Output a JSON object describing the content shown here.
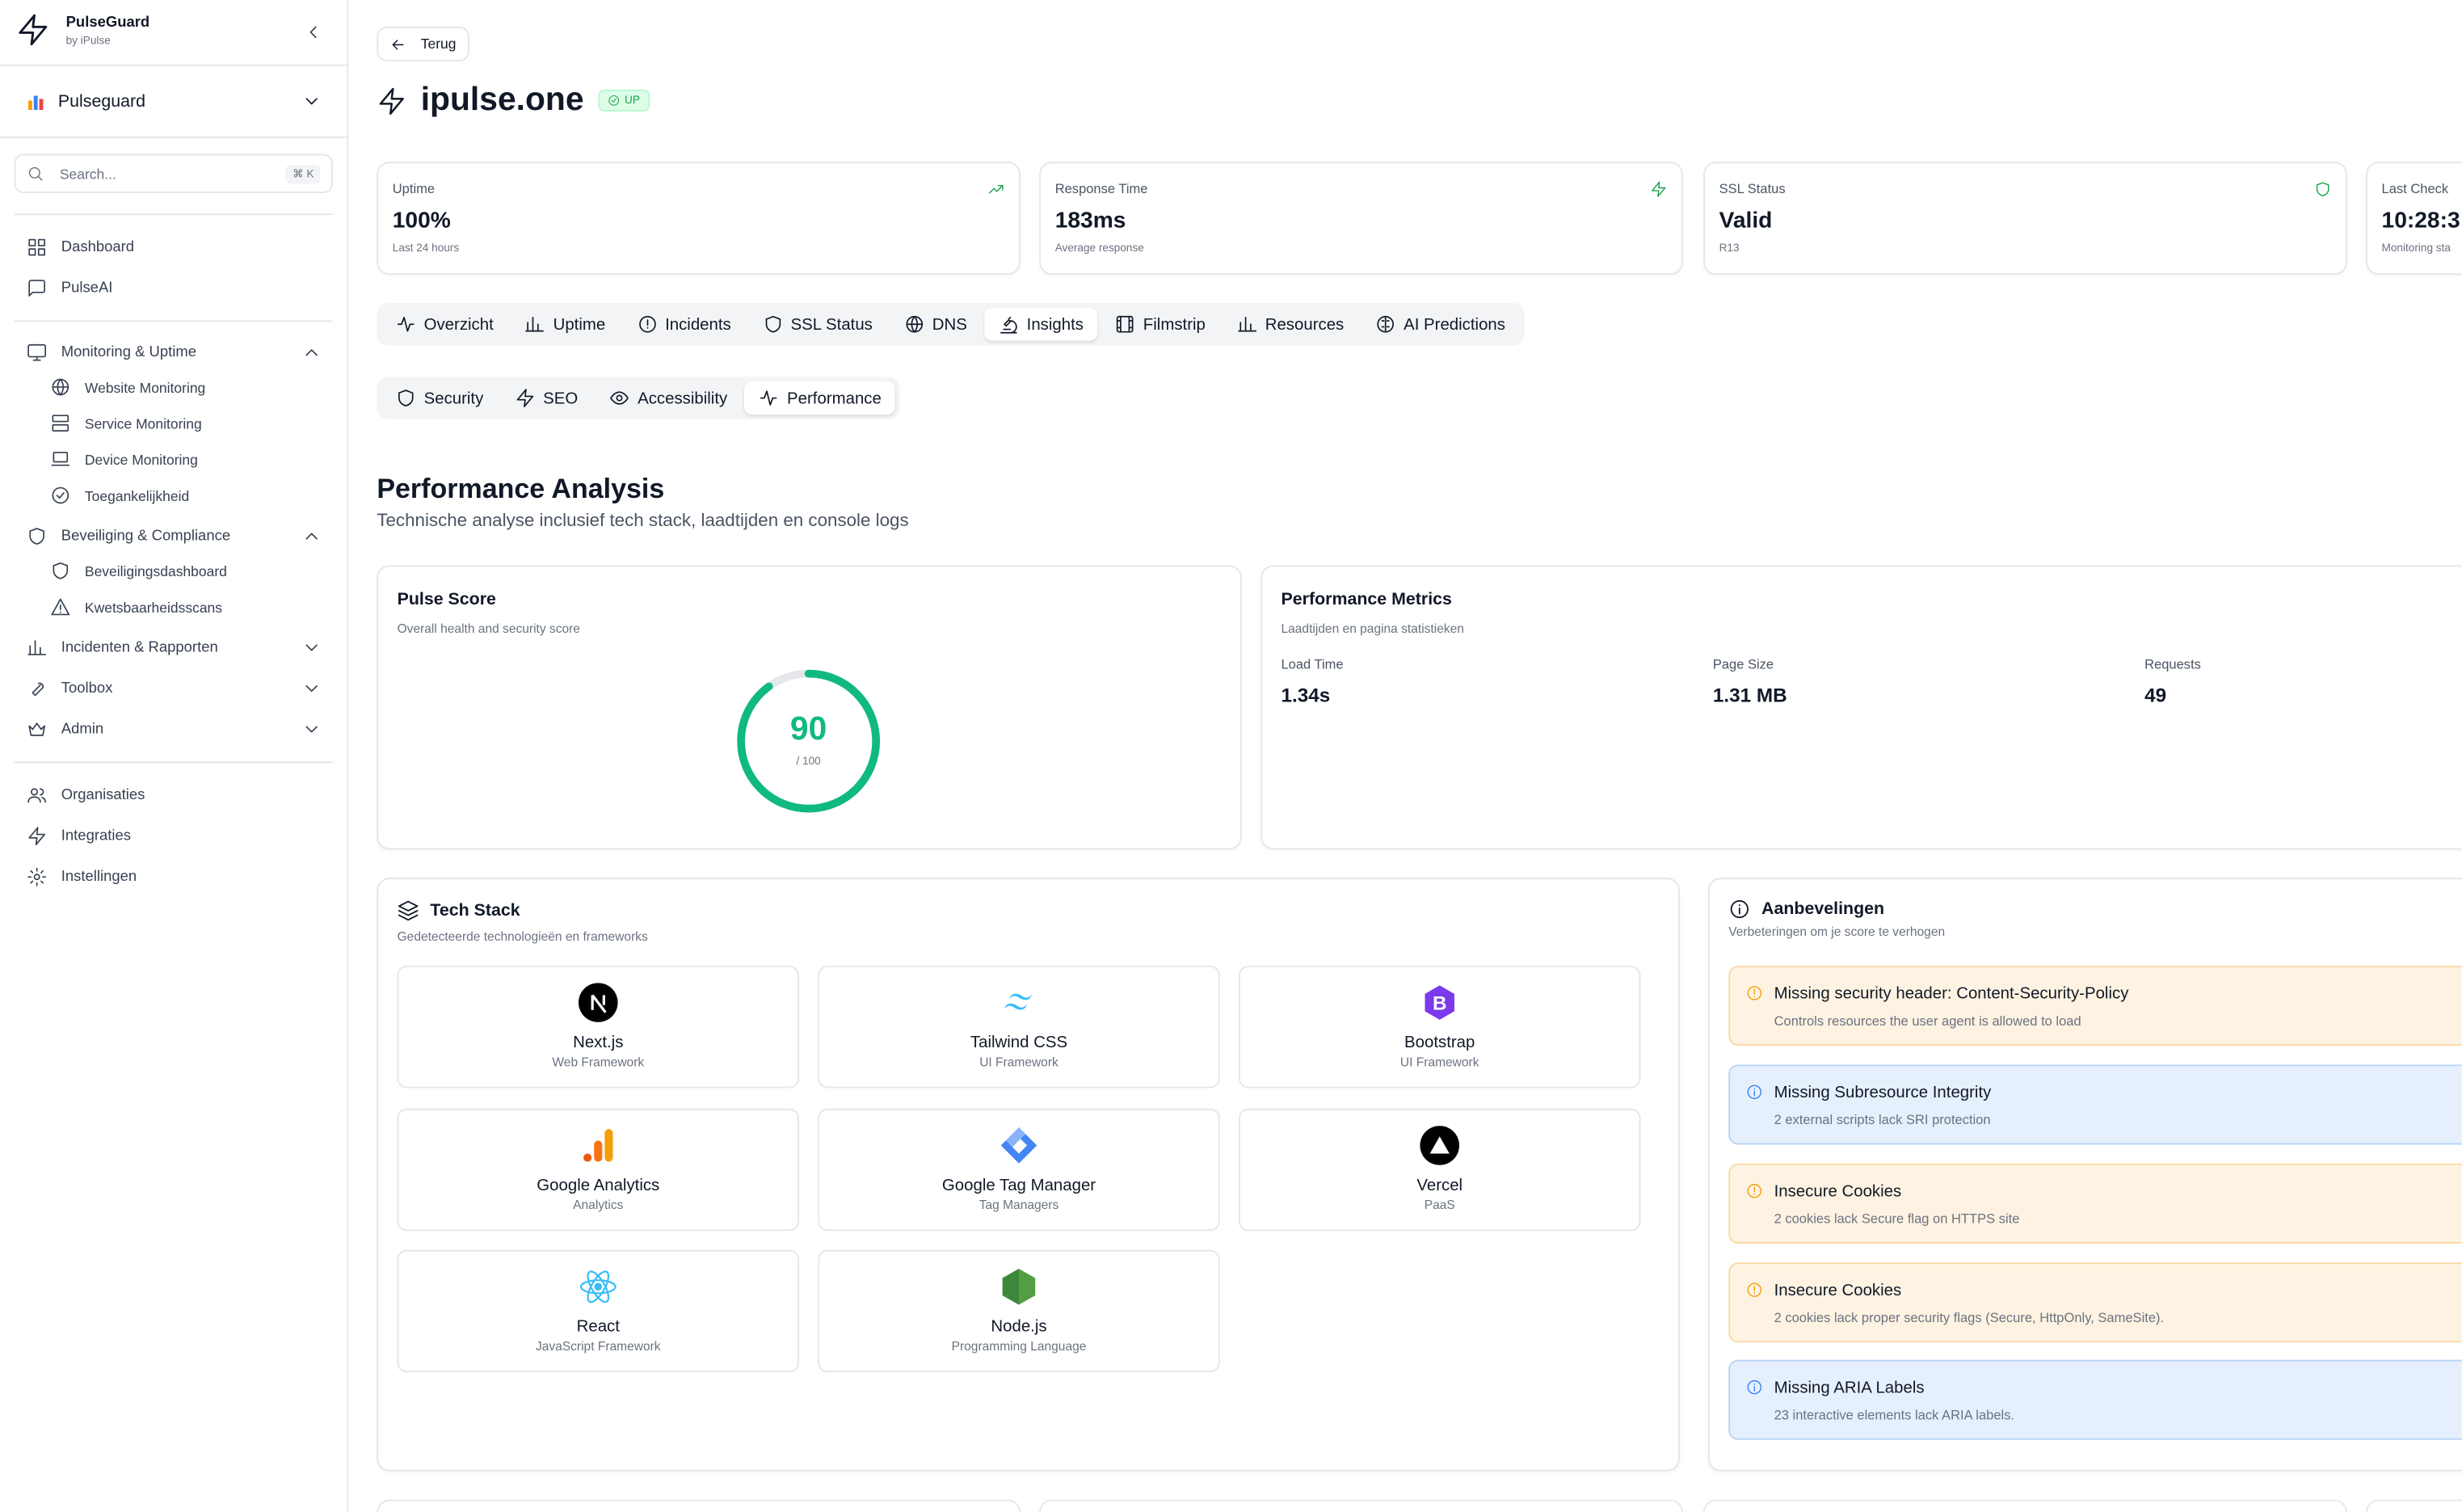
{
  "sidebar": {
    "brand": "PulseGuard",
    "by": "by iPulse",
    "org": "Pulseguard",
    "search_placeholder": "Search...",
    "kbd": "⌘ K",
    "items": [
      {
        "label": "Dashboard",
        "icon": "grid-icon"
      },
      {
        "label": "PulseAI",
        "icon": "chat-icon"
      },
      {
        "label": "Monitoring & Uptime",
        "icon": "monitor-icon"
      },
      {
        "label": "Website Monitoring",
        "icon": "globe-icon"
      },
      {
        "label": "Service Monitoring",
        "icon": "server-icon"
      },
      {
        "label": "Device Monitoring",
        "icon": "laptop-icon"
      },
      {
        "label": "Toegankelijkheid",
        "icon": "check-circle-icon"
      },
      {
        "label": "Beveiliging & Compliance",
        "icon": "shield-icon"
      },
      {
        "label": "Beveiligingsdashboard",
        "icon": "shield-icon"
      },
      {
        "label": "Kwetsbaarheidsscans",
        "icon": "warning-icon"
      },
      {
        "label": "Incidenten & Rapporten",
        "icon": "bar-chart-icon"
      },
      {
        "label": "Toolbox",
        "icon": "wrench-icon"
      },
      {
        "label": "Admin",
        "icon": "crown-icon"
      },
      {
        "label": "Organisaties",
        "icon": "users-icon"
      },
      {
        "label": "Integraties",
        "icon": "bolt-icon"
      },
      {
        "label": "Instellingen",
        "icon": "gear-icon"
      }
    ]
  },
  "header": {
    "back": "Terug",
    "title": "ipulse.one",
    "status": "UP"
  },
  "stats": [
    {
      "label": "Uptime",
      "value": "100%",
      "sub": "Last 24 hours"
    },
    {
      "label": "Response Time",
      "value": "183ms",
      "sub": "Average response"
    },
    {
      "label": "SSL Status",
      "value": "Valid",
      "sub": "R13"
    },
    {
      "label": "Last Check",
      "value": "10:28:3",
      "sub": "Monitoring sta"
    }
  ],
  "tabs": [
    "Overzicht",
    "Uptime",
    "Incidents",
    "SSL Status",
    "DNS",
    "Insights",
    "Filmstrip",
    "Resources",
    "AI Predictions"
  ],
  "subtabs": [
    "Security",
    "SEO",
    "Accessibility",
    "Performance"
  ],
  "section": {
    "title": "Performance Analysis",
    "subtitle": "Technische analyse inclusief tech stack, laadtijden en console logs"
  },
  "pulse": {
    "title": "Pulse Score",
    "subtitle": "Overall health and security score",
    "score": "90",
    "max": "/ 100",
    "fraction": 0.9
  },
  "metrics": {
    "title": "Performance Metrics",
    "subtitle": "Laadtijden en pagina statistieken",
    "items": [
      {
        "label": "Load Time",
        "value": "1.34s"
      },
      {
        "label": "Page Size",
        "value": "1.31 MB"
      },
      {
        "label": "Requests",
        "value": "49"
      }
    ]
  },
  "tech": {
    "title": "Tech Stack",
    "subtitle": "Gedetecteerde technologieën en frameworks",
    "items": [
      {
        "name": "Next.js",
        "category": "Web Framework",
        "icon": "nextjs-icon"
      },
      {
        "name": "Tailwind CSS",
        "category": "UI Framework",
        "icon": "tailwind-icon"
      },
      {
        "name": "Bootstrap",
        "category": "UI Framework",
        "icon": "bootstrap-icon"
      },
      {
        "name": "Google Analytics",
        "category": "Analytics",
        "icon": "google-analytics-icon"
      },
      {
        "name": "Google Tag Manager",
        "category": "Tag Managers",
        "icon": "gtm-icon"
      },
      {
        "name": "Vercel",
        "category": "PaaS",
        "icon": "vercel-icon"
      },
      {
        "name": "React",
        "category": "JavaScript Framework",
        "icon": "react-icon"
      },
      {
        "name": "Node.js",
        "category": "Programming Language",
        "icon": "nodejs-icon"
      }
    ]
  },
  "recs": {
    "title": "Aanbevelingen",
    "subtitle": "Verbeteringen om je score te verhogen",
    "items": [
      {
        "title": "Missing security header: Content-Security-Policy",
        "desc": "Controls resources the user agent is allowed to load",
        "level": "warning"
      },
      {
        "title": "Missing Subresource Integrity",
        "desc": "2 external scripts lack SRI protection",
        "level": "info"
      },
      {
        "title": "Insecure Cookies",
        "desc": "2 cookies lack Secure flag on HTTPS site",
        "level": "warning"
      },
      {
        "title": "Insecure Cookies",
        "desc": "2 cookies lack proper security flags (Secure, HttpOnly, SameSite).",
        "level": "warning"
      },
      {
        "title": "Missing ARIA Labels",
        "desc": "23 interactive elements lack ARIA labels.",
        "level": "info"
      }
    ]
  },
  "colors": {
    "accent": "#10b981",
    "warning": "#f59e0b",
    "info": "#3b82f6",
    "up": "#16a34a"
  }
}
